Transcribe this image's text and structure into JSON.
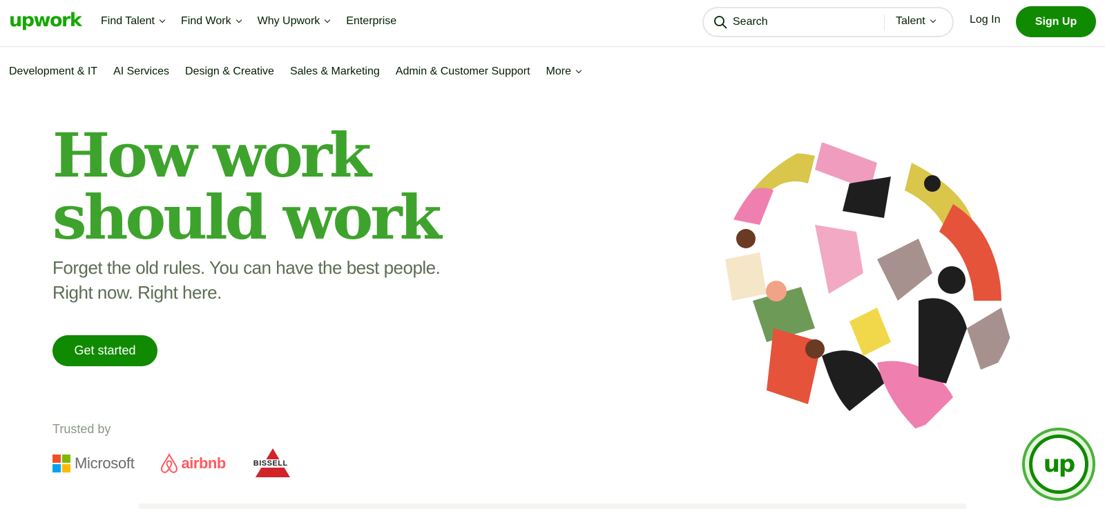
{
  "header": {
    "logo_text": "upwork",
    "nav": [
      {
        "label": "Find Talent",
        "has_menu": true
      },
      {
        "label": "Find Work",
        "has_menu": true
      },
      {
        "label": "Why Upwork",
        "has_menu": true
      },
      {
        "label": "Enterprise",
        "has_menu": false
      }
    ],
    "search": {
      "placeholder": "Search",
      "scope": "Talent"
    },
    "login_label": "Log In",
    "signup_label": "Sign Up"
  },
  "categories": [
    {
      "label": "Development & IT"
    },
    {
      "label": "AI Services"
    },
    {
      "label": "Design & Creative"
    },
    {
      "label": "Sales & Marketing"
    },
    {
      "label": "Admin & Customer Support"
    },
    {
      "label": "More",
      "has_menu": true
    }
  ],
  "hero": {
    "title_line1": "How work",
    "title_line2": "should work",
    "subtitle_line1": "Forget the old rules. You can have the best people.",
    "subtitle_line2": "Right now. Right here.",
    "cta_label": "Get started"
  },
  "trusted": {
    "label": "Trusted by",
    "brands": [
      "Microsoft",
      "airbnb",
      "BISSELL"
    ]
  },
  "badge_text": "up",
  "colors": {
    "brand_green": "#14a800",
    "button_green": "#108a00",
    "hero_green": "#3ea32c",
    "text_dark": "#001e00",
    "text_muted": "#5e6d55"
  }
}
